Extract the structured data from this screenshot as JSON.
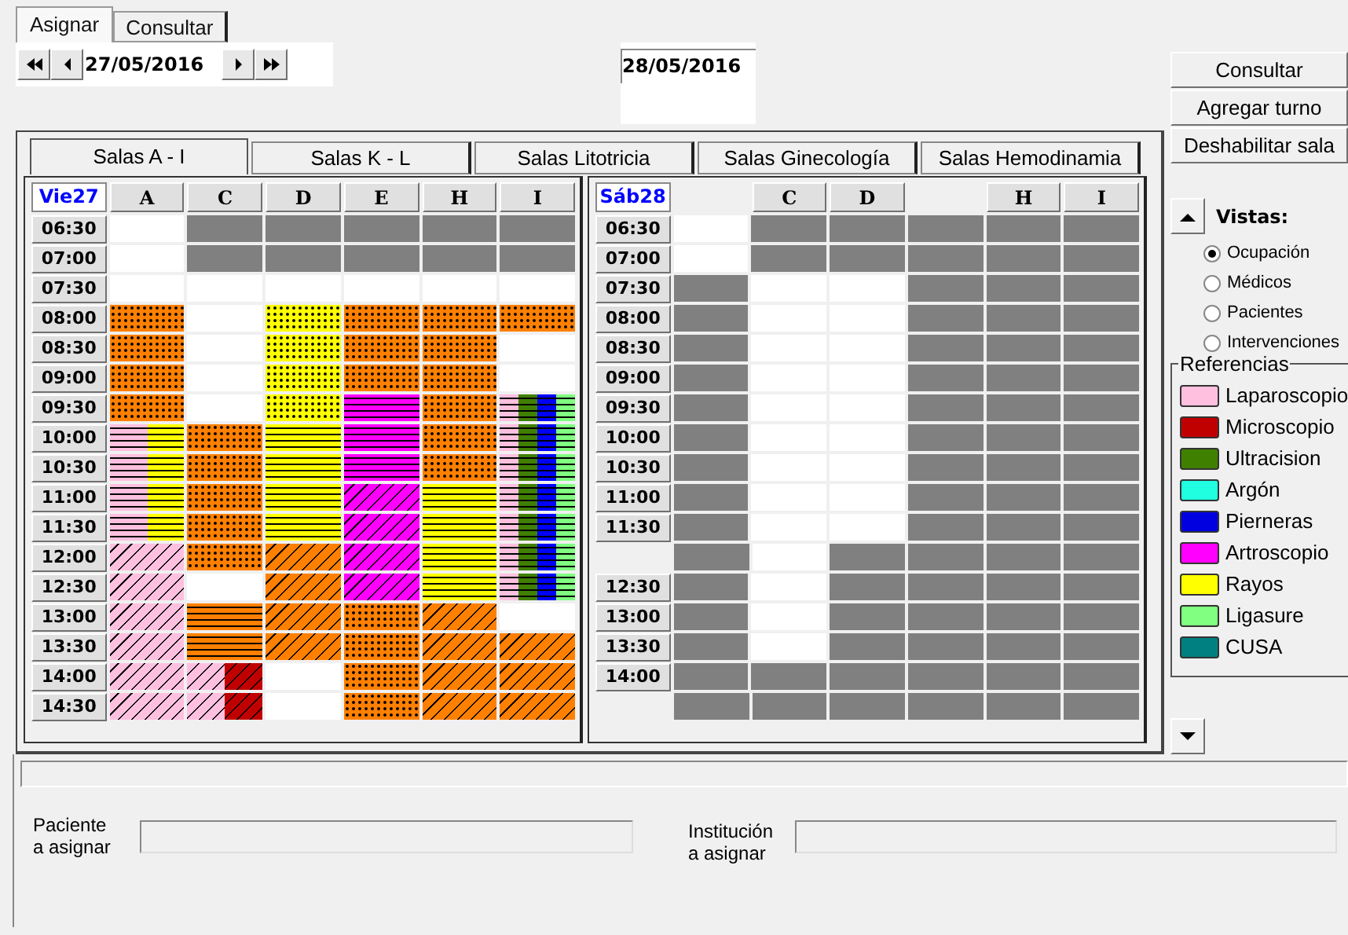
{
  "tabs": [
    {
      "label": "Asignar",
      "selected": true
    },
    {
      "label": "Consultar",
      "selected": false
    }
  ],
  "date_from": "27/05/2016",
  "date_to": "28/05/2016",
  "actions": [
    "Consultar",
    "Agregar turno",
    "Deshabilitar sala"
  ],
  "room_tabs": [
    {
      "label": "Salas A - I",
      "selected": true
    },
    {
      "label": "Salas K - L",
      "selected": false
    },
    {
      "label": "Salas Litotricia",
      "selected": false
    },
    {
      "label": "Salas Ginecología",
      "selected": false
    },
    {
      "label": "Salas Hemodinamia",
      "selected": false
    }
  ],
  "days": [
    {
      "day": "Vie27",
      "columns": [
        "A",
        "C",
        "D",
        "E",
        "H",
        "I"
      ],
      "rows": [
        {
          "time": "06:30",
          "cells": [
            {
              "kind": "free"
            },
            {
              "kind": "closed"
            },
            {
              "kind": "closed"
            },
            {
              "kind": "closed"
            },
            {
              "kind": "closed"
            },
            {
              "kind": "closed"
            }
          ]
        },
        {
          "time": "07:00",
          "cells": [
            {
              "kind": "free"
            },
            {
              "kind": "closed"
            },
            {
              "kind": "closed"
            },
            {
              "kind": "closed"
            },
            {
              "kind": "closed"
            },
            {
              "kind": "closed"
            }
          ]
        },
        {
          "time": "07:30",
          "cells": [
            {
              "kind": "free"
            },
            {
              "kind": "free"
            },
            {
              "kind": "free"
            },
            {
              "kind": "free"
            },
            {
              "kind": "free"
            },
            {
              "kind": "free"
            }
          ]
        },
        {
          "time": "08:00",
          "cells": [
            {
              "kind": "dotted",
              "segments": [
                {
                  "color": "#ff8000"
                }
              ]
            },
            {
              "kind": "free"
            },
            {
              "kind": "dotted",
              "segments": [
                {
                  "color": "#ffff00"
                }
              ]
            },
            {
              "kind": "dotted",
              "segments": [
                {
                  "color": "#ff8000"
                }
              ]
            },
            {
              "kind": "dotted",
              "segments": [
                {
                  "color": "#ff8000"
                }
              ]
            },
            {
              "kind": "dotted",
              "segments": [
                {
                  "color": "#ff8000"
                }
              ]
            }
          ]
        },
        {
          "time": "08:30",
          "cells": [
            {
              "kind": "dotted",
              "segments": [
                {
                  "color": "#ff8000"
                }
              ]
            },
            {
              "kind": "free"
            },
            {
              "kind": "dotted",
              "segments": [
                {
                  "color": "#ffff00"
                }
              ]
            },
            {
              "kind": "dotted",
              "segments": [
                {
                  "color": "#ff8000"
                }
              ]
            },
            {
              "kind": "dotted",
              "segments": [
                {
                  "color": "#ff8000"
                }
              ]
            },
            {
              "kind": "free"
            }
          ]
        },
        {
          "time": "09:00",
          "cells": [
            {
              "kind": "dotted",
              "segments": [
                {
                  "color": "#ff8000"
                }
              ]
            },
            {
              "kind": "free"
            },
            {
              "kind": "dotted",
              "segments": [
                {
                  "color": "#ffff00"
                }
              ]
            },
            {
              "kind": "dotted",
              "segments": [
                {
                  "color": "#ff8000"
                }
              ]
            },
            {
              "kind": "dotted",
              "segments": [
                {
                  "color": "#ff8000"
                }
              ]
            },
            {
              "kind": "free"
            }
          ]
        },
        {
          "time": "09:30",
          "cells": [
            {
              "kind": "dotted",
              "segments": [
                {
                  "color": "#ff8000"
                }
              ]
            },
            {
              "kind": "free"
            },
            {
              "kind": "dotted",
              "segments": [
                {
                  "color": "#ffff00"
                }
              ]
            },
            {
              "kind": "striped",
              "segments": [
                {
                  "color": "#ff00ff"
                }
              ]
            },
            {
              "kind": "dotted",
              "segments": [
                {
                  "color": "#ff8000"
                }
              ]
            },
            {
              "kind": "striped",
              "segments": [
                {
                  "color": "#ffc0e0"
                },
                {
                  "color": "#408000"
                },
                {
                  "color": "#0000ff"
                },
                {
                  "color": "#80ff80"
                }
              ]
            }
          ]
        },
        {
          "time": "10:00",
          "cells": [
            {
              "kind": "striped",
              "segments": [
                {
                  "color": "#ffc0e0"
                },
                {
                  "color": "#ffff00"
                }
              ]
            },
            {
              "kind": "dotted",
              "segments": [
                {
                  "color": "#ff8000"
                }
              ]
            },
            {
              "kind": "striped",
              "segments": [
                {
                  "color": "#ffff00"
                }
              ]
            },
            {
              "kind": "striped",
              "segments": [
                {
                  "color": "#ff00ff"
                }
              ]
            },
            {
              "kind": "dotted",
              "segments": [
                {
                  "color": "#ff8000"
                }
              ]
            },
            {
              "kind": "striped",
              "segments": [
                {
                  "color": "#ffc0e0"
                },
                {
                  "color": "#408000"
                },
                {
                  "color": "#0000ff"
                },
                {
                  "color": "#80ff80"
                }
              ]
            }
          ]
        },
        {
          "time": "10:30",
          "cells": [
            {
              "kind": "striped",
              "segments": [
                {
                  "color": "#ffc0e0"
                },
                {
                  "color": "#ffff00"
                }
              ]
            },
            {
              "kind": "dotted",
              "segments": [
                {
                  "color": "#ff8000"
                }
              ]
            },
            {
              "kind": "striped",
              "segments": [
                {
                  "color": "#ffff00"
                }
              ]
            },
            {
              "kind": "striped",
              "segments": [
                {
                  "color": "#ff00ff"
                }
              ]
            },
            {
              "kind": "dotted",
              "segments": [
                {
                  "color": "#ff8000"
                }
              ]
            },
            {
              "kind": "striped",
              "segments": [
                {
                  "color": "#ffc0e0"
                },
                {
                  "color": "#408000"
                },
                {
                  "color": "#0000ff"
                },
                {
                  "color": "#80ff80"
                }
              ]
            }
          ]
        },
        {
          "time": "11:00",
          "cells": [
            {
              "kind": "striped",
              "segments": [
                {
                  "color": "#ffc0e0"
                },
                {
                  "color": "#ffff00"
                }
              ]
            },
            {
              "kind": "dotted",
              "segments": [
                {
                  "color": "#ff8000"
                }
              ]
            },
            {
              "kind": "striped",
              "segments": [
                {
                  "color": "#ffff00"
                }
              ]
            },
            {
              "kind": "hatched",
              "segments": [
                {
                  "color": "#ff00ff"
                }
              ]
            },
            {
              "kind": "striped",
              "segments": [
                {
                  "color": "#ffff00"
                }
              ]
            },
            {
              "kind": "striped",
              "segments": [
                {
                  "color": "#ffc0e0"
                },
                {
                  "color": "#408000"
                },
                {
                  "color": "#0000ff"
                },
                {
                  "color": "#80ff80"
                }
              ]
            }
          ]
        },
        {
          "time": "11:30",
          "cells": [
            {
              "kind": "striped",
              "segments": [
                {
                  "color": "#ffc0e0"
                },
                {
                  "color": "#ffff00"
                }
              ]
            },
            {
              "kind": "dotted",
              "segments": [
                {
                  "color": "#ff8000"
                }
              ]
            },
            {
              "kind": "striped",
              "segments": [
                {
                  "color": "#ffff00"
                }
              ]
            },
            {
              "kind": "hatched",
              "segments": [
                {
                  "color": "#ff00ff"
                }
              ]
            },
            {
              "kind": "striped",
              "segments": [
                {
                  "color": "#ffff00"
                }
              ]
            },
            {
              "kind": "striped",
              "segments": [
                {
                  "color": "#ffc0e0"
                },
                {
                  "color": "#408000"
                },
                {
                  "color": "#0000ff"
                },
                {
                  "color": "#80ff80"
                }
              ]
            }
          ]
        },
        {
          "time": "12:00",
          "cells": [
            {
              "kind": "hatched",
              "segments": [
                {
                  "color": "#ffc0e0"
                }
              ]
            },
            {
              "kind": "dotted",
              "segments": [
                {
                  "color": "#ff8000"
                }
              ]
            },
            {
              "kind": "hatched",
              "segments": [
                {
                  "color": "#ff8000"
                }
              ]
            },
            {
              "kind": "hatched",
              "segments": [
                {
                  "color": "#ff00ff"
                }
              ]
            },
            {
              "kind": "striped",
              "segments": [
                {
                  "color": "#ffff00"
                }
              ]
            },
            {
              "kind": "striped",
              "segments": [
                {
                  "color": "#ffc0e0"
                },
                {
                  "color": "#408000"
                },
                {
                  "color": "#0000ff"
                },
                {
                  "color": "#80ff80"
                }
              ]
            }
          ]
        },
        {
          "time": "12:30",
          "cells": [
            {
              "kind": "hatched",
              "segments": [
                {
                  "color": "#ffc0e0"
                }
              ]
            },
            {
              "kind": "free"
            },
            {
              "kind": "hatched",
              "segments": [
                {
                  "color": "#ff8000"
                }
              ]
            },
            {
              "kind": "hatched",
              "segments": [
                {
                  "color": "#ff00ff"
                }
              ]
            },
            {
              "kind": "striped",
              "segments": [
                {
                  "color": "#ffff00"
                }
              ]
            },
            {
              "kind": "striped",
              "segments": [
                {
                  "color": "#ffc0e0"
                },
                {
                  "color": "#408000"
                },
                {
                  "color": "#0000ff"
                },
                {
                  "color": "#80ff80"
                }
              ]
            }
          ]
        },
        {
          "time": "13:00",
          "cells": [
            {
              "kind": "hatched",
              "segments": [
                {
                  "color": "#ffc0e0"
                }
              ]
            },
            {
              "kind": "striped",
              "segments": [
                {
                  "color": "#ff8000"
                }
              ]
            },
            {
              "kind": "hatched",
              "segments": [
                {
                  "color": "#ff8000"
                }
              ]
            },
            {
              "kind": "dotted",
              "segments": [
                {
                  "color": "#ff8000"
                }
              ]
            },
            {
              "kind": "hatched",
              "segments": [
                {
                  "color": "#ff8000"
                }
              ]
            },
            {
              "kind": "free"
            }
          ]
        },
        {
          "time": "13:30",
          "cells": [
            {
              "kind": "hatched",
              "segments": [
                {
                  "color": "#ffc0e0"
                }
              ]
            },
            {
              "kind": "striped",
              "segments": [
                {
                  "color": "#ff8000"
                }
              ]
            },
            {
              "kind": "hatched",
              "segments": [
                {
                  "color": "#ff8000"
                }
              ]
            },
            {
              "kind": "dotted",
              "segments": [
                {
                  "color": "#ff8000"
                }
              ]
            },
            {
              "kind": "hatched",
              "segments": [
                {
                  "color": "#ff8000"
                }
              ]
            },
            {
              "kind": "hatched",
              "segments": [
                {
                  "color": "#ff8000"
                }
              ]
            }
          ]
        },
        {
          "time": "14:00",
          "cells": [
            {
              "kind": "hatched",
              "segments": [
                {
                  "color": "#ffc0e0"
                }
              ]
            },
            {
              "kind": "hatched",
              "segments": [
                {
                  "color": "#ffc0e0"
                },
                {
                  "color": "#c00000"
                }
              ]
            },
            {
              "kind": "free"
            },
            {
              "kind": "dotted",
              "segments": [
                {
                  "color": "#ff8000"
                }
              ]
            },
            {
              "kind": "hatched",
              "segments": [
                {
                  "color": "#ff8000"
                }
              ]
            },
            {
              "kind": "hatched",
              "segments": [
                {
                  "color": "#ff8000"
                }
              ]
            }
          ]
        },
        {
          "time": "14:30",
          "cells": [
            {
              "kind": "hatched",
              "segments": [
                {
                  "color": "#ffc0e0"
                }
              ]
            },
            {
              "kind": "hatched",
              "segments": [
                {
                  "color": "#ffc0e0"
                },
                {
                  "color": "#c00000"
                }
              ]
            },
            {
              "kind": "free"
            },
            {
              "kind": "dotted",
              "segments": [
                {
                  "color": "#ff8000"
                }
              ]
            },
            {
              "kind": "hatched",
              "segments": [
                {
                  "color": "#ff8000"
                }
              ]
            },
            {
              "kind": "hatched",
              "segments": [
                {
                  "color": "#ff8000"
                }
              ]
            }
          ]
        }
      ]
    },
    {
      "day": "Sáb28",
      "columns": [
        null,
        "C",
        "D",
        null,
        "H",
        "I"
      ],
      "rows": [
        {
          "time": "06:30",
          "cells": [
            {
              "kind": "free"
            },
            {
              "kind": "closed"
            },
            {
              "kind": "closed"
            },
            {
              "kind": "closed"
            },
            {
              "kind": "closed"
            },
            {
              "kind": "closed"
            }
          ]
        },
        {
          "time": "07:00",
          "cells": [
            {
              "kind": "free"
            },
            {
              "kind": "closed"
            },
            {
              "kind": "closed"
            },
            {
              "kind": "closed"
            },
            {
              "kind": "closed"
            },
            {
              "kind": "closed"
            }
          ]
        },
        {
          "time": "07:30",
          "cells": [
            {
              "kind": "closed"
            },
            {
              "kind": "free"
            },
            {
              "kind": "free"
            },
            {
              "kind": "closed"
            },
            {
              "kind": "closed"
            },
            {
              "kind": "closed"
            }
          ]
        },
        {
          "time": "08:00",
          "cells": [
            {
              "kind": "closed"
            },
            {
              "kind": "free"
            },
            {
              "kind": "free"
            },
            {
              "kind": "closed"
            },
            {
              "kind": "closed"
            },
            {
              "kind": "closed"
            }
          ]
        },
        {
          "time": "08:30",
          "cells": [
            {
              "kind": "closed"
            },
            {
              "kind": "free"
            },
            {
              "kind": "free"
            },
            {
              "kind": "closed"
            },
            {
              "kind": "closed"
            },
            {
              "kind": "closed"
            }
          ]
        },
        {
          "time": "09:00",
          "cells": [
            {
              "kind": "closed"
            },
            {
              "kind": "free"
            },
            {
              "kind": "free"
            },
            {
              "kind": "closed"
            },
            {
              "kind": "closed"
            },
            {
              "kind": "closed"
            }
          ]
        },
        {
          "time": "09:30",
          "cells": [
            {
              "kind": "closed"
            },
            {
              "kind": "free"
            },
            {
              "kind": "free"
            },
            {
              "kind": "closed"
            },
            {
              "kind": "closed"
            },
            {
              "kind": "closed"
            }
          ]
        },
        {
          "time": "10:00",
          "cells": [
            {
              "kind": "closed"
            },
            {
              "kind": "free"
            },
            {
              "kind": "free"
            },
            {
              "kind": "closed"
            },
            {
              "kind": "closed"
            },
            {
              "kind": "closed"
            }
          ]
        },
        {
          "time": "10:30",
          "cells": [
            {
              "kind": "closed"
            },
            {
              "kind": "free"
            },
            {
              "kind": "free"
            },
            {
              "kind": "closed"
            },
            {
              "kind": "closed"
            },
            {
              "kind": "closed"
            }
          ]
        },
        {
          "time": "11:00",
          "cells": [
            {
              "kind": "closed"
            },
            {
              "kind": "free"
            },
            {
              "kind": "free"
            },
            {
              "kind": "closed"
            },
            {
              "kind": "closed"
            },
            {
              "kind": "closed"
            }
          ]
        },
        {
          "time": "11:30",
          "cells": [
            {
              "kind": "closed"
            },
            {
              "kind": "free"
            },
            {
              "kind": "free"
            },
            {
              "kind": "closed"
            },
            {
              "kind": "closed"
            },
            {
              "kind": "closed"
            }
          ]
        },
        {
          "cells": [
            {
              "kind": "closed"
            },
            {
              "kind": "free"
            },
            {
              "kind": "closed"
            },
            {
              "kind": "closed"
            },
            {
              "kind": "closed"
            },
            {
              "kind": "closed"
            }
          ]
        },
        {
          "time": "12:30",
          "cells": [
            {
              "kind": "closed"
            },
            {
              "kind": "free"
            },
            {
              "kind": "closed"
            },
            {
              "kind": "closed"
            },
            {
              "kind": "closed"
            },
            {
              "kind": "closed"
            }
          ]
        },
        {
          "time": "13:00",
          "cells": [
            {
              "kind": "closed"
            },
            {
              "kind": "free"
            },
            {
              "kind": "closed"
            },
            {
              "kind": "closed"
            },
            {
              "kind": "closed"
            },
            {
              "kind": "closed"
            }
          ]
        },
        {
          "time": "13:30",
          "cells": [
            {
              "kind": "closed"
            },
            {
              "kind": "free"
            },
            {
              "kind": "closed"
            },
            {
              "kind": "closed"
            },
            {
              "kind": "closed"
            },
            {
              "kind": "closed"
            }
          ]
        },
        {
          "time": "14:00",
          "cells": [
            {
              "kind": "closed"
            },
            {
              "kind": "closed"
            },
            {
              "kind": "closed"
            },
            {
              "kind": "closed"
            },
            {
              "kind": "closed"
            },
            {
              "kind": "closed"
            }
          ]
        },
        {
          "cells": [
            {
              "kind": "closed"
            },
            {
              "kind": "closed"
            },
            {
              "kind": "closed"
            },
            {
              "kind": "closed"
            },
            {
              "kind": "closed"
            },
            {
              "kind": "closed"
            }
          ]
        }
      ]
    }
  ],
  "views": {
    "title": "Vistas:",
    "options": [
      {
        "label": "Ocupación",
        "selected": true
      },
      {
        "label": "Médicos",
        "selected": false
      },
      {
        "label": "Pacientes",
        "selected": false
      },
      {
        "label": "Intervenciones",
        "selected": false
      }
    ]
  },
  "references": {
    "title": "Referencias",
    "items": [
      {
        "label": "Laparoscopio",
        "color": "#ffc0e0"
      },
      {
        "label": "Microscopio",
        "color": "#c00000"
      },
      {
        "label": "Ultracision",
        "color": "#408000"
      },
      {
        "label": "Argón",
        "color": "#20ffe0"
      },
      {
        "label": "Pierneras",
        "color": "#0000e0"
      },
      {
        "label": "Artroscopio",
        "color": "#ff00ff"
      },
      {
        "label": "Rayos",
        "color": "#ffff00"
      },
      {
        "label": "Ligasure",
        "color": "#80ff80"
      },
      {
        "label": "CUSA",
        "color": "#008080"
      }
    ]
  },
  "fields": [
    {
      "label": "Paciente\na asignar"
    },
    {
      "label": "Institución\na asignar"
    }
  ]
}
